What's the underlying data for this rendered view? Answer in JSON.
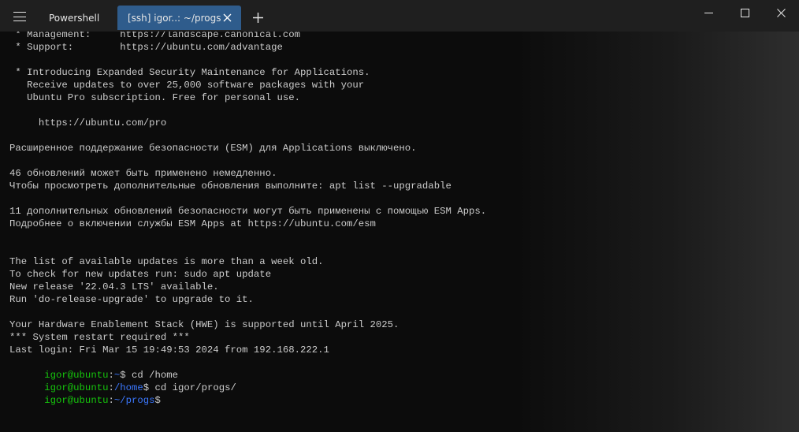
{
  "titlebar": {
    "menu_icon": "hamburger-menu-icon",
    "tabs": [
      {
        "label": "Powershell",
        "active": false
      },
      {
        "label": "[ssh] igor..: ~/progs",
        "active": true
      }
    ],
    "close_tab_glyph": "✕",
    "new_tab_glyph": "+",
    "window_controls": {
      "minimize": "minimize-icon",
      "maximize": "maximize-icon",
      "close": "close-icon"
    }
  },
  "colors": {
    "background": "#0c0c0c",
    "titlebar": "#1f1f1f",
    "active_tab": "#2f5c8c",
    "text": "#cccccc",
    "prompt_user": "#16c60c",
    "prompt_path": "#3b78ff"
  },
  "terminal": {
    "lines": [
      " * Management:     https://landscape.canonical.com",
      " * Support:        https://ubuntu.com/advantage",
      "",
      " * Introducing Expanded Security Maintenance for Applications.",
      "   Receive updates to over 25,000 software packages with your",
      "   Ubuntu Pro subscription. Free for personal use.",
      "",
      "     https://ubuntu.com/pro",
      "",
      "Расширенное поддержание безопасности (ESM) для Applications выключено.",
      "",
      "46 обновлений может быть применено немедленно.",
      "Чтобы просмотреть дополнительные обновления выполните: apt list --upgradable",
      "",
      "11 дополнительных обновлений безопасности могут быть применены с помощью ESM Apps.",
      "Подробнее о включении службы ESM Apps at https://ubuntu.com/esm",
      "",
      "",
      "The list of available updates is more than a week old.",
      "To check for new updates run: sudo apt update",
      "New release '22.04.3 LTS' available.",
      "Run 'do-release-upgrade' to upgrade to it.",
      "",
      "Your Hardware Enablement Stack (HWE) is supported until April 2025.",
      "*** System restart required ***",
      "Last login: Fri Mar 15 19:49:53 2024 from 192.168.222.1"
    ],
    "prompts": [
      {
        "user": "igor@ubuntu",
        "sep": ":",
        "path": "~",
        "symbol": "$ ",
        "command": "cd /home"
      },
      {
        "user": "igor@ubuntu",
        "sep": ":",
        "path": "/home",
        "symbol": "$ ",
        "command": "cd igor/progs/"
      },
      {
        "user": "igor@ubuntu",
        "sep": ":",
        "path": "~/progs",
        "symbol": "$",
        "command": ""
      }
    ]
  }
}
